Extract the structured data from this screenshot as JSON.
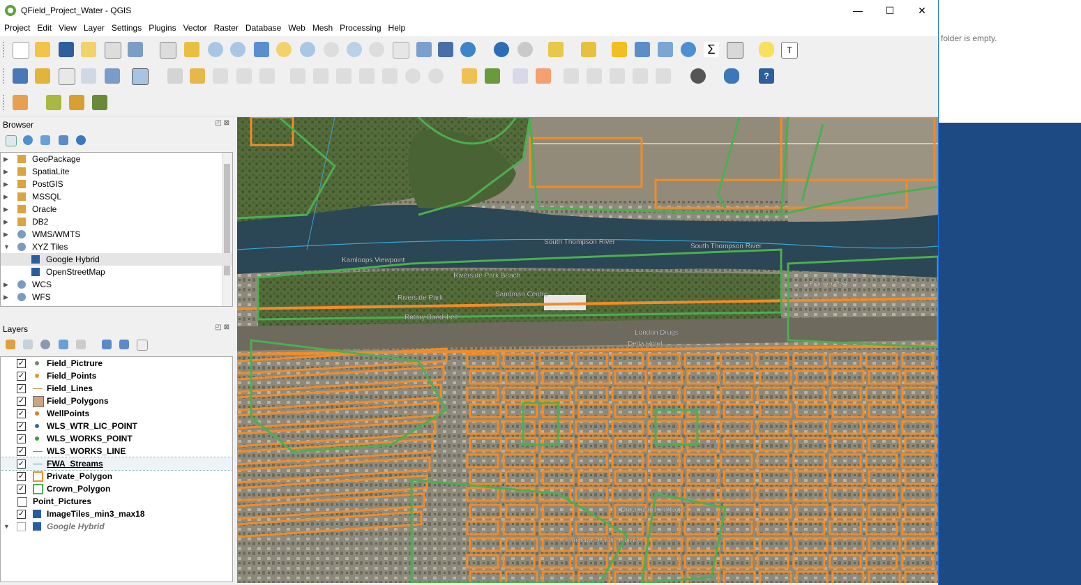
{
  "window": {
    "title": "QField_Project_Water - QGIS",
    "controls": {
      "minimize": "—",
      "maximize": "☐",
      "close": "✕"
    }
  },
  "menu": [
    "Project",
    "Edit",
    "View",
    "Layer",
    "Settings",
    "Plugins",
    "Vector",
    "Raster",
    "Database",
    "Web",
    "Mesh",
    "Processing",
    "Help"
  ],
  "browser": {
    "title": "Browser",
    "items": [
      {
        "label": "GeoPackage",
        "icon": "geopackage-icon",
        "expanded": false
      },
      {
        "label": "SpatiaLite",
        "icon": "spatialite-icon",
        "expanded": false
      },
      {
        "label": "PostGIS",
        "icon": "postgis-icon",
        "expanded": false
      },
      {
        "label": "MSSQL",
        "icon": "mssql-icon",
        "expanded": false
      },
      {
        "label": "Oracle",
        "icon": "oracle-icon",
        "expanded": false
      },
      {
        "label": "DB2",
        "icon": "db2-icon",
        "expanded": false
      },
      {
        "label": "WMS/WMTS",
        "icon": "globe-icon",
        "expanded": false
      },
      {
        "label": "XYZ Tiles",
        "icon": "globe-icon",
        "expanded": true
      },
      {
        "label": "Google Hybrid",
        "icon": "xyz-tile-icon",
        "child": true,
        "selected": true
      },
      {
        "label": "OpenStreetMap",
        "icon": "xyz-tile-icon",
        "child": true
      },
      {
        "label": "WCS",
        "icon": "globe-icon"
      },
      {
        "label": "WFS",
        "icon": "globe-icon"
      }
    ]
  },
  "layers": {
    "title": "Layers",
    "items": [
      {
        "label": "Field_Pictrure",
        "checked": true,
        "sym": "point",
        "color": "#6f8a6f"
      },
      {
        "label": "Field_Points",
        "checked": true,
        "sym": "point",
        "color": "#d89b30"
      },
      {
        "label": "Field_Lines",
        "checked": true,
        "sym": "line",
        "color": "#c58a3a"
      },
      {
        "label": "Field_Polygons",
        "checked": true,
        "sym": "fill",
        "color": "#c7a585"
      },
      {
        "label": "WellPoints",
        "checked": true,
        "sym": "point",
        "color": "#e07a20"
      },
      {
        "label": "WLS_WTR_LIC_POINT",
        "checked": true,
        "sym": "point",
        "color": "#3b6aa0"
      },
      {
        "label": "WLS_WORKS_POINT",
        "checked": true,
        "sym": "point",
        "color": "#3e9a3e"
      },
      {
        "label": "WLS_WORKS_LINE",
        "checked": true,
        "sym": "line",
        "color": "#888888"
      },
      {
        "label": "FWA_Streams",
        "checked": true,
        "sym": "line",
        "color": "#3aa0c8",
        "selected": true
      },
      {
        "label": "Private_Polygon",
        "checked": true,
        "sym": "outline",
        "color": "#f28c28"
      },
      {
        "label": "Crown_Polygon",
        "checked": true,
        "sym": "outline",
        "color": "#4caf50"
      },
      {
        "label": "Point_Pictures",
        "checked": null,
        "sym": "table"
      },
      {
        "label": "ImageTiles_min3_max18",
        "checked": true,
        "sym": "raster"
      },
      {
        "label": "Google Hybrid",
        "checked": false,
        "sym": "raster",
        "italic": true
      }
    ]
  },
  "side_panel": {
    "message": "folder is empty."
  },
  "map": {
    "labels": [
      "South Thompson River",
      "South Thompson River",
      "Riverside Park",
      "Kamloops Viewpoint",
      "Pioneer Park",
      "Rotary Bandshell",
      "Sandman Centre",
      "London Drugs",
      "Delta Hotel",
      "Kamloops Public Library",
      "Downtown Kamloops",
      "Riverside Park Beach"
    ]
  }
}
